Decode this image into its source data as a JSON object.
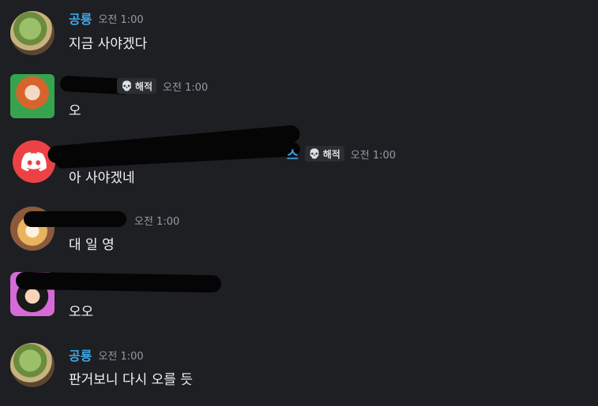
{
  "messages": [
    {
      "author": "공룡",
      "time": "오전 1:00",
      "text": "지금 사야겠다"
    },
    {
      "badge": "해적",
      "time": "오전 1:00",
      "text": "오"
    },
    {
      "badge": "해적",
      "time": "오전 1:00",
      "text": "아 사야겠네",
      "author_visible_fragment": "스"
    },
    {
      "time": "오전 1:00",
      "text": "대 일 영"
    },
    {
      "text": "오오"
    },
    {
      "author": "공룡",
      "time": "오전 1:00",
      "text": "판거보니 다시 오를 듯"
    }
  ],
  "icons": {
    "discord": "discord-logo-icon",
    "skull": "skull-icon"
  },
  "colors": {
    "background": "#1e1f22",
    "username": "#3ea6e5",
    "timestamp": "#949ba4",
    "discord_red": "#ed4245"
  }
}
